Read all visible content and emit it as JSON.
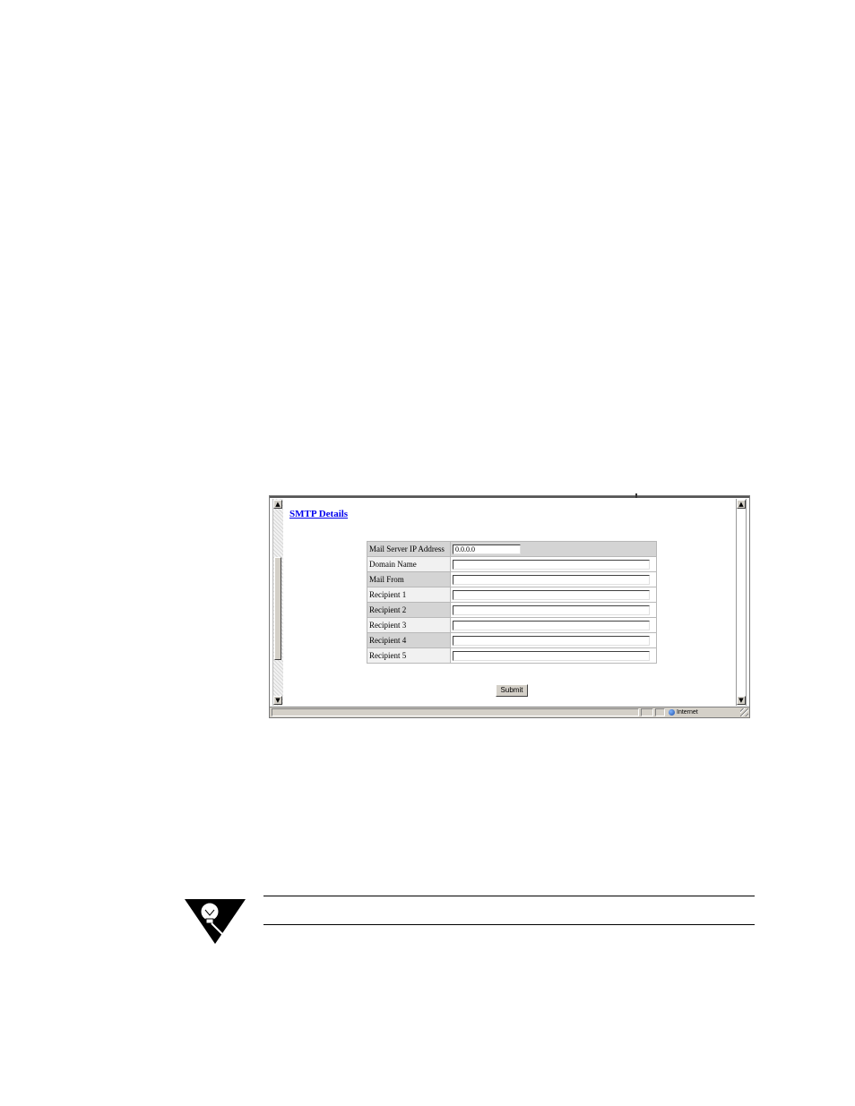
{
  "page": {
    "title": "SMTP Details",
    "submit_label": "Submit"
  },
  "form": {
    "rows": [
      {
        "label": "Mail Server IP Address",
        "value": "0.0.0.0"
      },
      {
        "label": "Domain Name",
        "value": ""
      },
      {
        "label": "Mail From",
        "value": ""
      },
      {
        "label": "Recipient 1",
        "value": ""
      },
      {
        "label": "Recipient 2",
        "value": ""
      },
      {
        "label": "Recipient 3",
        "value": ""
      },
      {
        "label": "Recipient 4",
        "value": ""
      },
      {
        "label": "Recipient 5",
        "value": ""
      }
    ]
  },
  "statusbar": {
    "zone": "Internet"
  },
  "icons": {
    "scroll_up": "scroll-up-icon",
    "scroll_down": "scroll-down-icon",
    "zone": "globe-icon",
    "resize": "resize-grip-icon",
    "tip": "lightbulb-tip-icon"
  },
  "colors": {
    "link": "#0000ee",
    "row_dark": "#d4d4d4",
    "row_light": "#f1f1f1",
    "chrome": "#d4d0c8"
  }
}
